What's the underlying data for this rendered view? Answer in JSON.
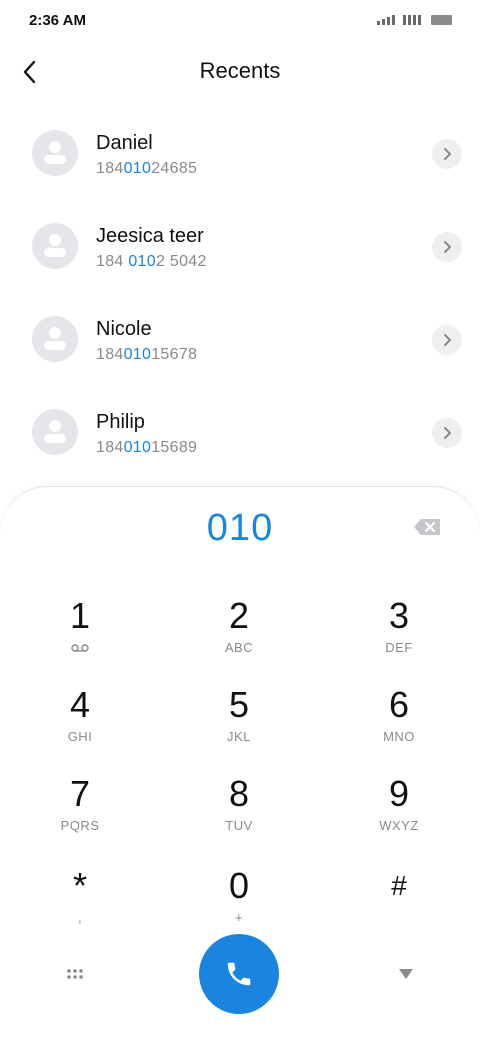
{
  "status_bar": {
    "time": "2:36 AM"
  },
  "header": {
    "title": "Recents",
    "back_icon": "chevron-left-icon"
  },
  "contacts": [
    {
      "name": "Daniel",
      "number_parts": [
        "184",
        "010",
        "24685"
      ]
    },
    {
      "name": "Jeesica teer",
      "number_parts": [
        "184 ",
        "010",
        "2 5042"
      ]
    },
    {
      "name": "Nicole",
      "number_parts": [
        "184",
        "010",
        "15678"
      ]
    },
    {
      "name": "Philip",
      "number_parts": [
        "184",
        "010",
        "15689"
      ]
    }
  ],
  "dialpad": {
    "input": "010",
    "keys": [
      {
        "digit": "1",
        "letters": "",
        "icon": "voicemail-icon"
      },
      {
        "digit": "2",
        "letters": "ABC"
      },
      {
        "digit": "3",
        "letters": "DEF"
      },
      {
        "digit": "4",
        "letters": "GHI"
      },
      {
        "digit": "5",
        "letters": "JKL"
      },
      {
        "digit": "6",
        "letters": "MNO"
      },
      {
        "digit": "7",
        "letters": "PQRS"
      },
      {
        "digit": "8",
        "letters": "TUV"
      },
      {
        "digit": "9",
        "letters": "WXYZ"
      },
      {
        "digit": "*",
        "letters": ","
      },
      {
        "digit": "0",
        "letters": "+"
      },
      {
        "digit": "#",
        "letters": ""
      }
    ]
  },
  "colors": {
    "accent": "#1a85e0",
    "muted_text": "#8a8a8a",
    "avatar_bg": "#e4e6ea"
  }
}
